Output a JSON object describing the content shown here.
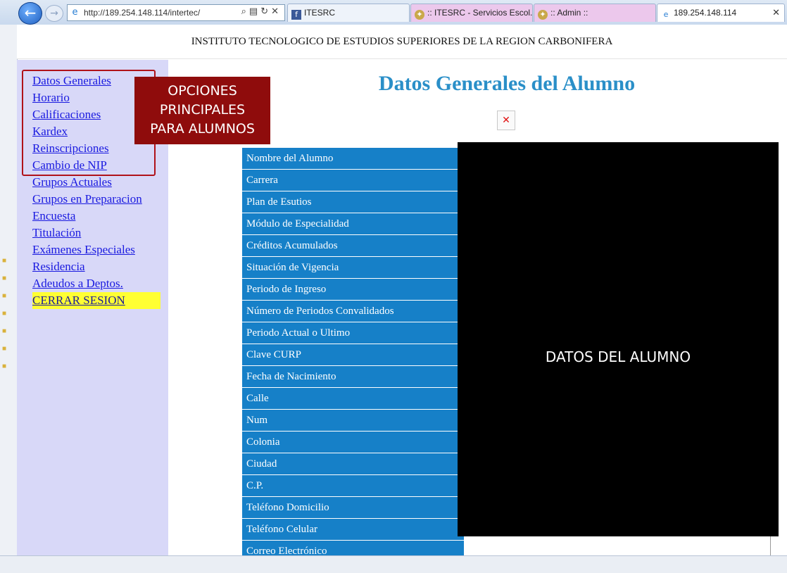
{
  "browser": {
    "url": "http://189.254.148.114/intertec/",
    "tabs": [
      {
        "label": "ITESRC",
        "icon": "facebook-icon"
      },
      {
        "label": ":: ITESRC - Servicios Escol...",
        "icon": "seal-icon"
      },
      {
        "label": ":: Admin ::",
        "icon": "seal-icon"
      },
      {
        "label": "189.254.148.114",
        "icon": "ie-icon"
      }
    ]
  },
  "header": {
    "institution": "INSTITUTO TECNOLOGICO DE ESTUDIOS SUPERIORES DE LA REGION CARBONIFERA"
  },
  "sidebar": {
    "items": [
      {
        "label": "Datos Generales"
      },
      {
        "label": "Horario"
      },
      {
        "label": "Calificaciones"
      },
      {
        "label": "Kardex"
      },
      {
        "label": "Reinscripciones"
      },
      {
        "label": "Cambio de NIP"
      },
      {
        "label": "Grupos Actuales"
      },
      {
        "label": "Grupos en Preparacion"
      },
      {
        "label": "Encuesta"
      },
      {
        "label": "Titulación"
      },
      {
        "label": "Exámenes Especiales"
      },
      {
        "label": "Residencia"
      },
      {
        "label": "Adeudos a Deptos."
      },
      {
        "label": "CERRAR SESION"
      }
    ]
  },
  "callout": {
    "lines": [
      "OPCIONES",
      "PRINCIPALES",
      "PARA ALUMNOS"
    ]
  },
  "main": {
    "title": "Datos Generales del Alumno",
    "fields": [
      "Nombre del Alumno",
      "Carrera",
      "Plan de Esutios",
      "Módulo de Especialidad",
      "Créditos Acumulados",
      "Situación de Vigencia",
      "Periodo de Ingreso",
      "Número de Periodos Convalidados",
      "Periodo Actual o Ultimo",
      "Clave CURP",
      "Fecha de Nacimiento",
      "Calle",
      "Num",
      "Colonia",
      "Ciudad",
      "C.P.",
      "Teléfono Domicilio",
      "Teléfono Celular",
      "Correo Electrónico"
    ],
    "redaction_caption": "DATOS DEL ALUMNO"
  },
  "colors": {
    "field_label_bg": "#1680c8",
    "title": "#2a8fc8",
    "sidebar_bg": "#d8d8f8",
    "callout_bg": "#8f0c0c",
    "logout_bg": "#ffff33"
  }
}
